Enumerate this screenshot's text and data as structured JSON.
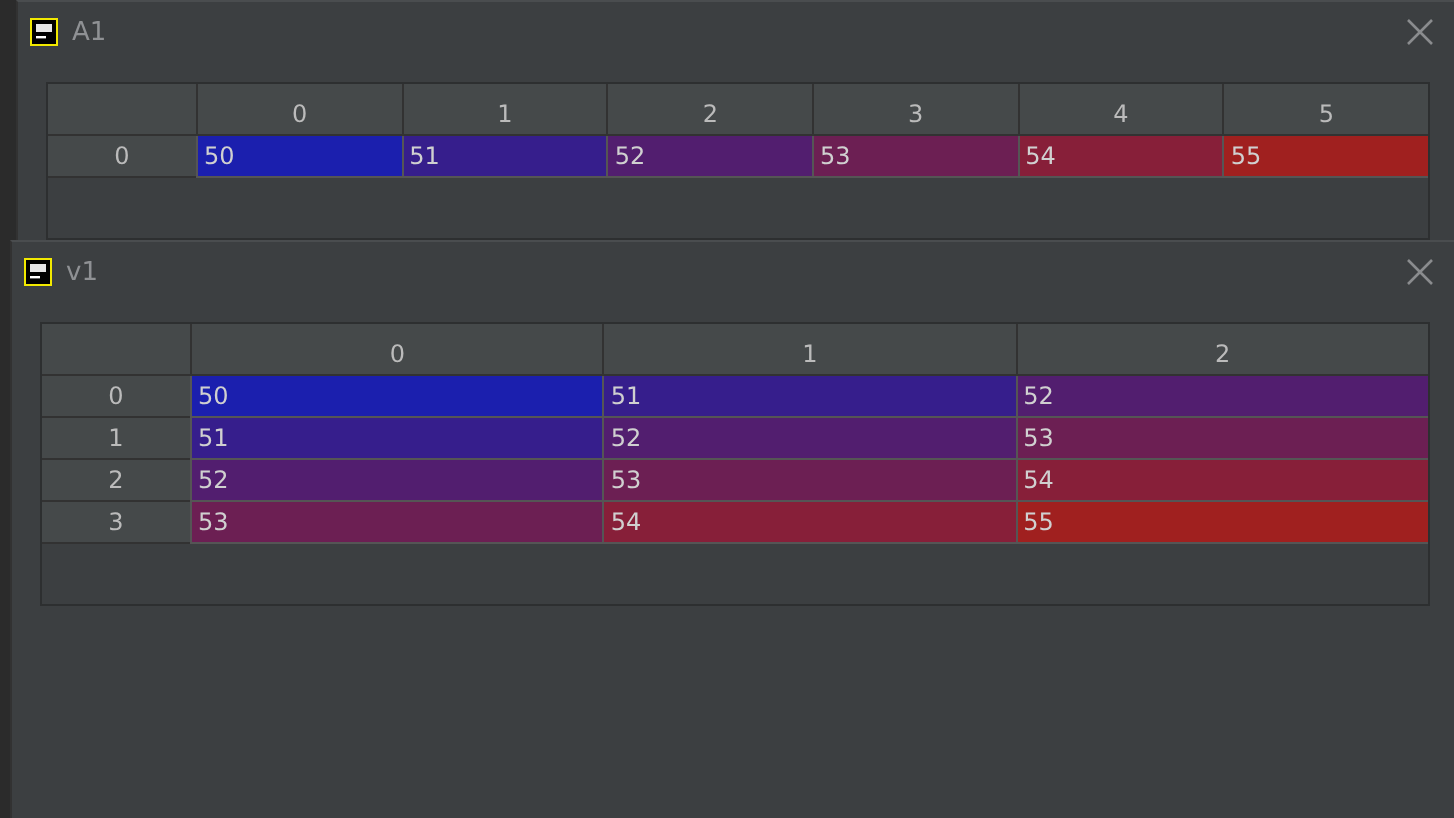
{
  "windows": [
    {
      "title": "A1",
      "columns": [
        "0",
        "1",
        "2",
        "3",
        "4",
        "5"
      ],
      "rows": [
        {
          "index": "0",
          "cells": [
            {
              "value": "50",
              "color": "#1b1fae"
            },
            {
              "value": "51",
              "color": "#361e8c"
            },
            {
              "value": "52",
              "color": "#521e6f"
            },
            {
              "value": "53",
              "color": "#6c1f53"
            },
            {
              "value": "54",
              "color": "#871f39"
            },
            {
              "value": "55",
              "color": "#a0201f"
            }
          ]
        }
      ]
    },
    {
      "title": "v1",
      "columns": [
        "0",
        "1",
        "2"
      ],
      "rows": [
        {
          "index": "0",
          "cells": [
            {
              "value": "50",
              "color": "#1b1fae"
            },
            {
              "value": "51",
              "color": "#361e8c"
            },
            {
              "value": "52",
              "color": "#521e6f"
            }
          ]
        },
        {
          "index": "1",
          "cells": [
            {
              "value": "51",
              "color": "#361e8c"
            },
            {
              "value": "52",
              "color": "#521e6f"
            },
            {
              "value": "53",
              "color": "#6c1f53"
            }
          ]
        },
        {
          "index": "2",
          "cells": [
            {
              "value": "52",
              "color": "#521e6f"
            },
            {
              "value": "53",
              "color": "#6c1f53"
            },
            {
              "value": "54",
              "color": "#871f39"
            }
          ]
        },
        {
          "index": "3",
          "cells": [
            {
              "value": "53",
              "color": "#6c1f53"
            },
            {
              "value": "54",
              "color": "#871f39"
            },
            {
              "value": "55",
              "color": "#a0201f"
            }
          ]
        }
      ]
    }
  ]
}
